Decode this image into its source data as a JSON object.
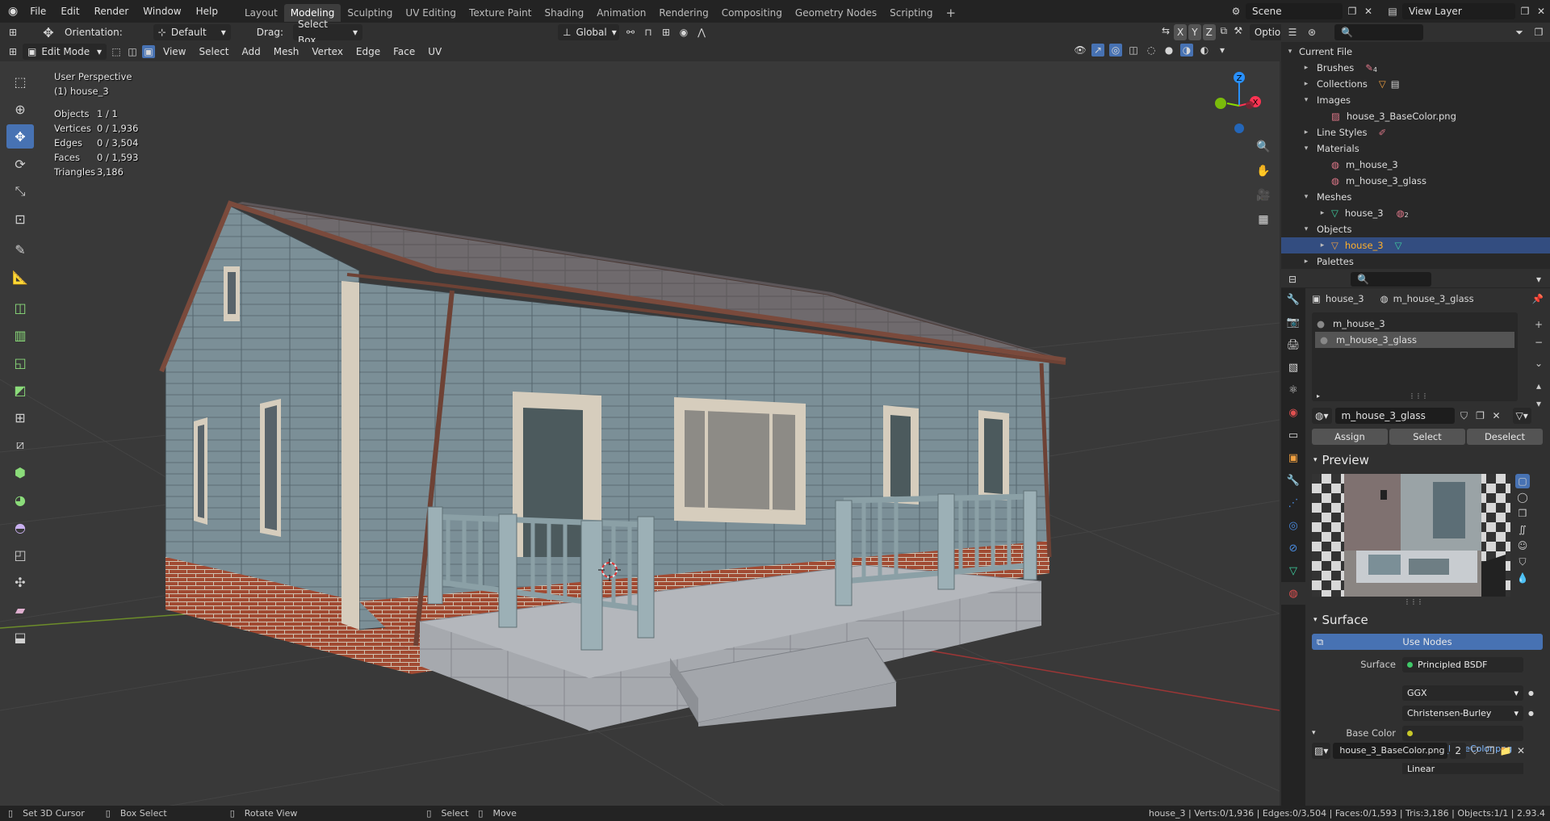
{
  "colors": {
    "accent": "#4772b3",
    "selected_row": "#334d80",
    "selected_text": "#ffaf29",
    "x_axis": "#ff3352",
    "y_axis": "#8bdc00",
    "z_axis": "#2890ff"
  },
  "topbar": {
    "menus": [
      "File",
      "Edit",
      "Render",
      "Window",
      "Help"
    ],
    "workspaces": [
      "Layout",
      "Modeling",
      "Sculpting",
      "UV Editing",
      "Texture Paint",
      "Shading",
      "Animation",
      "Rendering",
      "Compositing",
      "Geometry Nodes",
      "Scripting"
    ],
    "active_workspace": "Modeling",
    "add_tab": "+",
    "scene": "Scene",
    "view_layer": "View Layer"
  },
  "viewport_header": {
    "orientation_label": "Orientation:",
    "orientation_value": "Default",
    "drag_label": "Drag:",
    "drag_value": "Select Box",
    "transform_space": "Global",
    "axes": [
      "X",
      "Y",
      "Z"
    ],
    "options": "Options",
    "mode": "Edit Mode",
    "menus": [
      "View",
      "Select",
      "Add",
      "Mesh",
      "Vertex",
      "Edge",
      "Face",
      "UV"
    ]
  },
  "overlay": {
    "view_name": "User Perspective",
    "object_name": "(1) house_3",
    "stats": [
      {
        "label": "Objects",
        "value": "1 / 1"
      },
      {
        "label": "Vertices",
        "value": "0 / 1,936"
      },
      {
        "label": "Edges",
        "value": "0 / 3,504"
      },
      {
        "label": "Faces",
        "value": "0 / 1,593"
      },
      {
        "label": "Triangles",
        "value": "3,186"
      }
    ]
  },
  "gizmo": {
    "x": "X",
    "y": "Y",
    "z": "Z"
  },
  "tools": [
    "select-box",
    "cursor",
    "move",
    "rotate",
    "scale",
    "transform",
    "annotate",
    "measure",
    "add-cube",
    "extrude",
    "inset",
    "bevel",
    "loop-cut",
    "knife",
    "poly-build",
    "spin",
    "smooth",
    "edge-slide",
    "shrink-fatten",
    "shear",
    "rip"
  ],
  "outliner": {
    "search_placeholder": "",
    "root": "Current File",
    "rows": [
      {
        "label": "Brushes",
        "level": 1,
        "expanded": false,
        "badge": "4"
      },
      {
        "label": "Collections",
        "level": 1,
        "expanded": false
      },
      {
        "label": "Images",
        "level": 1,
        "expanded": true
      },
      {
        "label": "house_3_BaseColor.png",
        "level": 2,
        "leaf": true
      },
      {
        "label": "Line Styles",
        "level": 1,
        "expanded": false
      },
      {
        "label": "Materials",
        "level": 1,
        "expanded": true
      },
      {
        "label": "m_house_3",
        "level": 2,
        "leaf": true
      },
      {
        "label": "m_house_3_glass",
        "level": 2,
        "leaf": true
      },
      {
        "label": "Meshes",
        "level": 1,
        "expanded": true
      },
      {
        "label": "house_3",
        "level": 2,
        "expanded": false,
        "badge": "2"
      },
      {
        "label": "Objects",
        "level": 1,
        "expanded": true
      },
      {
        "label": "house_3",
        "level": 2,
        "expanded": false,
        "selected": true
      },
      {
        "label": "Palettes",
        "level": 1,
        "expanded": false
      }
    ]
  },
  "properties": {
    "breadcrumb_object": "house_3",
    "breadcrumb_material": "m_house_3_glass",
    "slots": [
      "m_house_3",
      "m_house_3_glass"
    ],
    "selected_slot": 1,
    "material_name": "m_house_3_glass",
    "assign": "Assign",
    "select": "Select",
    "deselect": "Deselect",
    "preview_title": "Preview",
    "surface_title": "Surface",
    "use_nodes": "Use Nodes",
    "surface_label": "Surface",
    "surface_value": "Principled BSDF",
    "distribution": "GGX",
    "subsurface": "Christensen-Burley",
    "base_color_label": "Base Color",
    "base_color_value": "house_3_BaseColor.png",
    "image_name": "house_3_BaseColor.png",
    "image_users": "2",
    "interpolation": "Linear"
  },
  "statusbar": {
    "actions": [
      {
        "icon": "mouse-left-icon",
        "label": "Set 3D Cursor"
      },
      {
        "icon": "mouse-left-icon",
        "label": "Box Select"
      },
      {
        "icon": "mouse-middle-icon",
        "label": "Rotate View"
      },
      {
        "icon": "mouse-left-icon",
        "label": "Select"
      },
      {
        "icon": "mouse-left-icon",
        "label": "Move"
      }
    ],
    "info": "house_3 | Verts:0/1,936 | Edges:0/3,504 | Faces:0/1,593 | Tris:3,186 | Objects:1/1 | 2.93.4"
  }
}
